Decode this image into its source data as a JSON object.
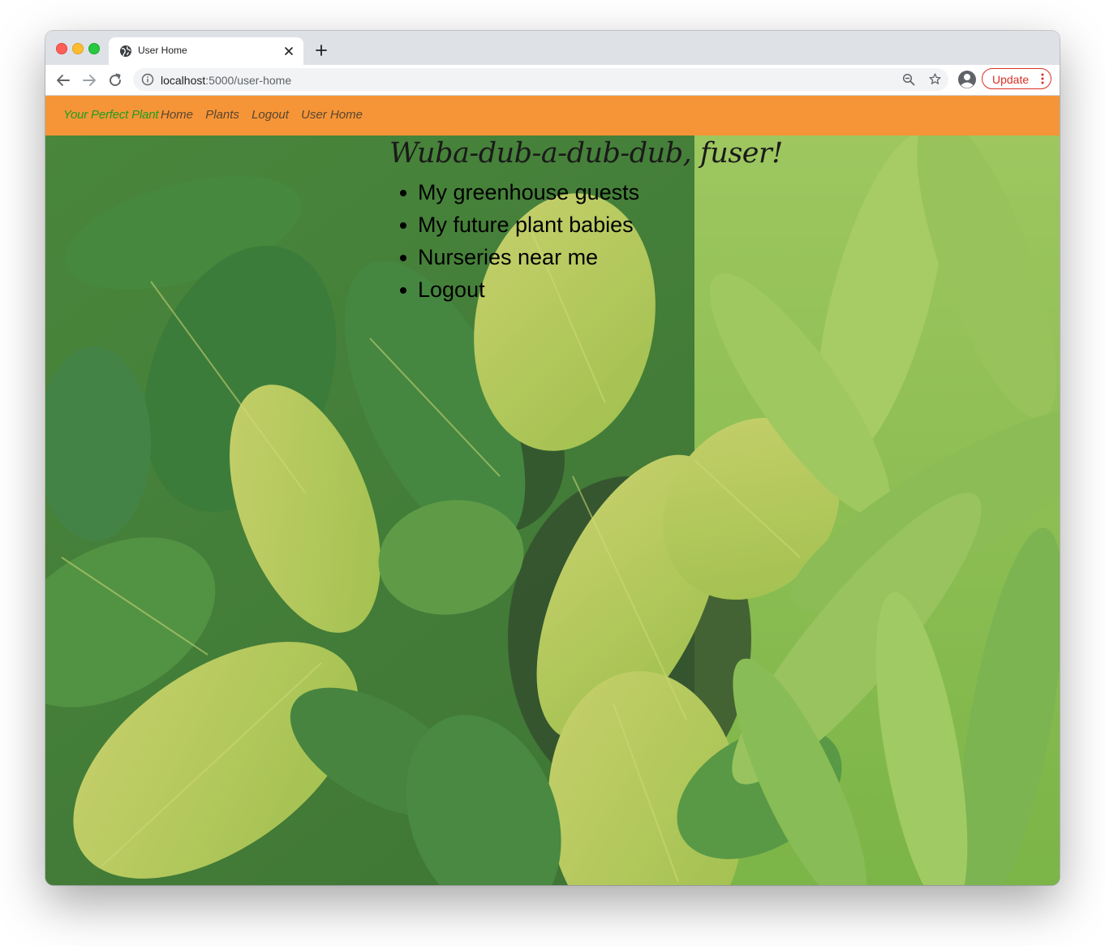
{
  "browser": {
    "tab_title": "User Home",
    "url_host": "localhost",
    "url_path": ":5000/user-home",
    "update_label": "Update"
  },
  "navbar": {
    "brand": "Your Perfect Plant",
    "links": [
      "Home",
      "Plants",
      "Logout",
      "User Home"
    ],
    "background": "#f69537",
    "brand_color": "#1f9d1f"
  },
  "main": {
    "greeting": "Wuba-dub-a-dub-dub, fuser!",
    "menu": [
      "My greenhouse guests",
      "My future plant babies",
      "Nurseries near me",
      "Logout"
    ],
    "background_image": "leafy plants photo (croton and dracaena)"
  },
  "icons": {
    "globe": "globe-icon",
    "close": "close-icon",
    "new_tab": "plus-icon",
    "back": "back-arrow-icon",
    "forward": "forward-arrow-icon",
    "reload": "reload-icon",
    "info": "info-icon",
    "zoom": "zoom-out-icon",
    "star": "bookmark-star-icon",
    "profile": "profile-avatar-icon",
    "menu": "kebab-menu-icon"
  }
}
